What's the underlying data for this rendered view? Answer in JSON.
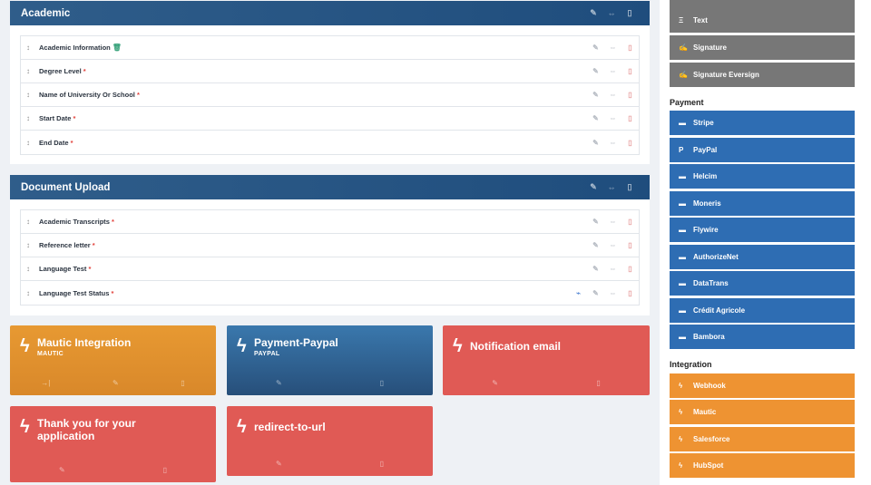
{
  "academic": {
    "title": "Academic",
    "rows": [
      {
        "label": "Academic Information",
        "required": "",
        "extra": "🗑"
      },
      {
        "label": "Degree Level",
        "required": "*"
      },
      {
        "label": "Name of University Or School",
        "required": "*"
      },
      {
        "label": "Start Date",
        "required": "*"
      },
      {
        "label": "End Date",
        "required": "*"
      }
    ]
  },
  "documents": {
    "title": "Document Upload",
    "rows": [
      {
        "label": "Academic Transcripts",
        "required": "*"
      },
      {
        "label": "Reference letter",
        "required": "*"
      },
      {
        "label": "Language Test",
        "required": "*"
      },
      {
        "label": "Language Test Status",
        "required": "*"
      }
    ]
  },
  "cards": [
    {
      "title": "Mautic Integration",
      "sub": "MAUTIC"
    },
    {
      "title": "Payment-Paypal",
      "sub": "PAYPAL"
    },
    {
      "title": "Notification email",
      "sub": ""
    },
    {
      "title": "Thank you for your application",
      "sub": ""
    },
    {
      "title": "redirect-to-url",
      "sub": ""
    }
  ],
  "sidebar": {
    "top_items": [
      "Text",
      "Signature",
      "Signature Eversign"
    ],
    "payment_heading": "Payment",
    "payment_items": [
      "Stripe",
      "PayPal",
      "Helcim",
      "Moneris",
      "Flywire",
      "AuthorizeNet",
      "DataTrans",
      "Crédit Agricole",
      "Bambora"
    ],
    "integration_heading": "Integration",
    "integration_items": [
      "Webhook",
      "Mautic",
      "Salesforce",
      "HubSpot"
    ]
  },
  "colors": {
    "header_blue": "#1f4d7d",
    "card_orange": "#e79932",
    "card_red": "#e05a55",
    "payment_blue": "#2e6db3",
    "integration_orange": "#ee9332",
    "gray_button": "#777777"
  }
}
